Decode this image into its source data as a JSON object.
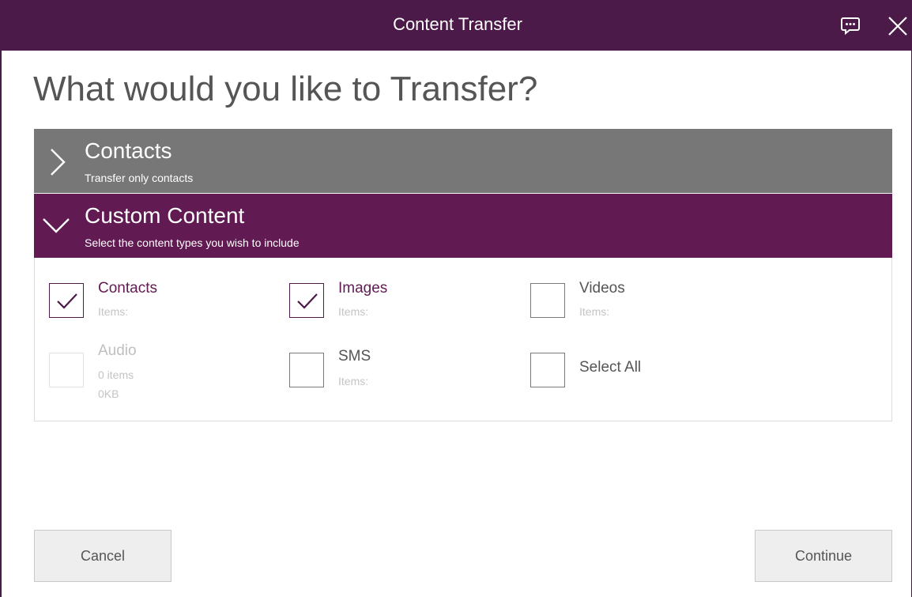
{
  "window": {
    "title": "Content Transfer"
  },
  "titlebar": {
    "feedback_icon": "feedback-icon",
    "close_icon": "close-icon"
  },
  "heading": "What would you like to Transfer?",
  "panels": [
    {
      "title": "Contacts",
      "subtitle": "Transfer only contacts",
      "state": "collapsed"
    },
    {
      "title": "Custom Content",
      "subtitle": "Select the content types you wish to include",
      "state": "expanded"
    }
  ],
  "options": [
    {
      "label": "Contacts",
      "sub1": "Items:",
      "sub2": "",
      "checked": true,
      "disabled": false
    },
    {
      "label": "Images",
      "sub1": "Items:",
      "sub2": "",
      "checked": true,
      "disabled": false
    },
    {
      "label": "Videos",
      "sub1": "Items:",
      "sub2": "",
      "checked": false,
      "disabled": false
    },
    {
      "label": "Audio",
      "sub1": "0 items",
      "sub2": "0KB",
      "checked": false,
      "disabled": true
    },
    {
      "label": "SMS",
      "sub1": "Items:",
      "sub2": "",
      "checked": false,
      "disabled": false
    },
    {
      "label": "Select All",
      "sub1": "",
      "sub2": "",
      "checked": false,
      "disabled": false
    }
  ],
  "buttons": {
    "cancel": "Cancel",
    "continue": "Continue"
  },
  "colors": {
    "titlebar": "#4b1a48",
    "accent": "#611a52",
    "collapsed_panel": "#777777",
    "button_bg": "#eeeeee"
  }
}
